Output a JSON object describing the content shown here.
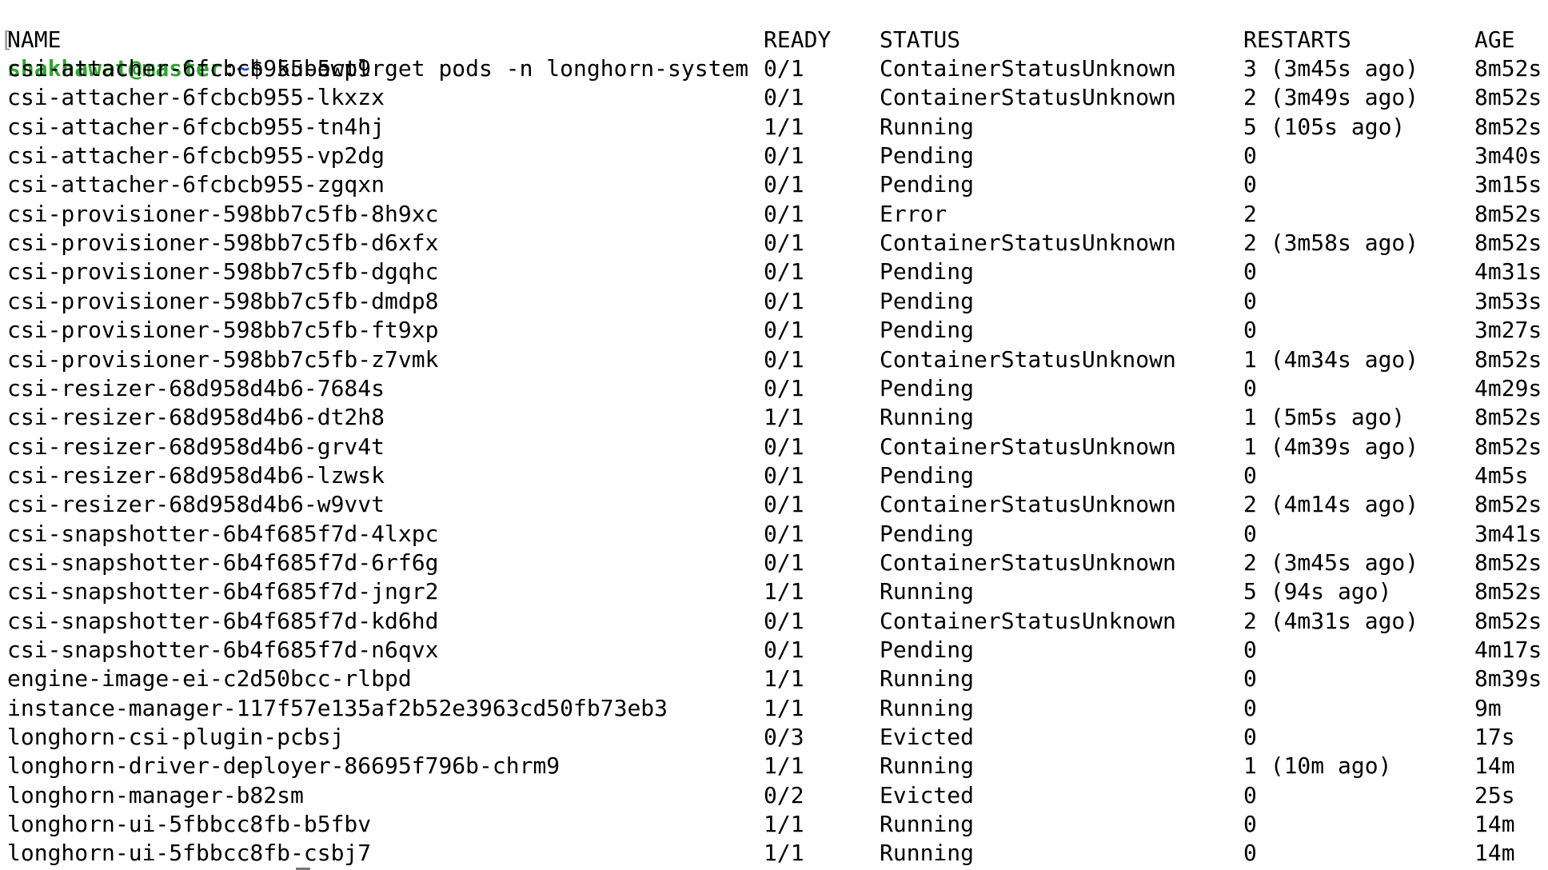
{
  "prompt": {
    "bracket": "[",
    "user_host": "shakhawat@master",
    "colon": ":",
    "path": "~",
    "symbol": "$",
    "command": " kubectl get pods -n longhorn-system"
  },
  "table": {
    "headers": [
      "NAME",
      "READY",
      "STATUS",
      "RESTARTS",
      "AGE"
    ],
    "rows": [
      [
        "csi-attacher-6fcbcb955-5wp9r",
        "0/1",
        "ContainerStatusUnknown",
        "3 (3m45s ago)",
        "8m52s"
      ],
      [
        "csi-attacher-6fcbcb955-lkxzx",
        "0/1",
        "ContainerStatusUnknown",
        "2 (3m49s ago)",
        "8m52s"
      ],
      [
        "csi-attacher-6fcbcb955-tn4hj",
        "1/1",
        "Running",
        "5 (105s ago)",
        "8m52s"
      ],
      [
        "csi-attacher-6fcbcb955-vp2dg",
        "0/1",
        "Pending",
        "0",
        "3m40s"
      ],
      [
        "csi-attacher-6fcbcb955-zgqxn",
        "0/1",
        "Pending",
        "0",
        "3m15s"
      ],
      [
        "csi-provisioner-598bb7c5fb-8h9xc",
        "0/1",
        "Error",
        "2",
        "8m52s"
      ],
      [
        "csi-provisioner-598bb7c5fb-d6xfx",
        "0/1",
        "ContainerStatusUnknown",
        "2 (3m58s ago)",
        "8m52s"
      ],
      [
        "csi-provisioner-598bb7c5fb-dgqhc",
        "0/1",
        "Pending",
        "0",
        "4m31s"
      ],
      [
        "csi-provisioner-598bb7c5fb-dmdp8",
        "0/1",
        "Pending",
        "0",
        "3m53s"
      ],
      [
        "csi-provisioner-598bb7c5fb-ft9xp",
        "0/1",
        "Pending",
        "0",
        "3m27s"
      ],
      [
        "csi-provisioner-598bb7c5fb-z7vmk",
        "0/1",
        "ContainerStatusUnknown",
        "1 (4m34s ago)",
        "8m52s"
      ],
      [
        "csi-resizer-68d958d4b6-7684s",
        "0/1",
        "Pending",
        "0",
        "4m29s"
      ],
      [
        "csi-resizer-68d958d4b6-dt2h8",
        "1/1",
        "Running",
        "1 (5m5s ago)",
        "8m52s"
      ],
      [
        "csi-resizer-68d958d4b6-grv4t",
        "0/1",
        "ContainerStatusUnknown",
        "1 (4m39s ago)",
        "8m52s"
      ],
      [
        "csi-resizer-68d958d4b6-lzwsk",
        "0/1",
        "Pending",
        "0",
        "4m5s"
      ],
      [
        "csi-resizer-68d958d4b6-w9vvt",
        "0/1",
        "ContainerStatusUnknown",
        "2 (4m14s ago)",
        "8m52s"
      ],
      [
        "csi-snapshotter-6b4f685f7d-4lxpc",
        "0/1",
        "Pending",
        "0",
        "3m41s"
      ],
      [
        "csi-snapshotter-6b4f685f7d-6rf6g",
        "0/1",
        "ContainerStatusUnknown",
        "2 (3m45s ago)",
        "8m52s"
      ],
      [
        "csi-snapshotter-6b4f685f7d-jngr2",
        "1/1",
        "Running",
        "5 (94s ago)",
        "8m52s"
      ],
      [
        "csi-snapshotter-6b4f685f7d-kd6hd",
        "0/1",
        "ContainerStatusUnknown",
        "2 (4m31s ago)",
        "8m52s"
      ],
      [
        "csi-snapshotter-6b4f685f7d-n6qvx",
        "0/1",
        "Pending",
        "0",
        "4m17s"
      ],
      [
        "engine-image-ei-c2d50bcc-rlbpd",
        "1/1",
        "Running",
        "0",
        "8m39s"
      ],
      [
        "instance-manager-117f57e135af2b52e3963cd50fb73eb3",
        "1/1",
        "Running",
        "0",
        "9m"
      ],
      [
        "longhorn-csi-plugin-pcbsj",
        "0/3",
        "Evicted",
        "0",
        "17s"
      ],
      [
        "longhorn-driver-deployer-86695f796b-chrm9",
        "1/1",
        "Running",
        "1 (10m ago)",
        "14m"
      ],
      [
        "longhorn-manager-b82sm",
        "0/2",
        "Evicted",
        "0",
        "25s"
      ],
      [
        "longhorn-ui-5fbbcc8fb-b5fbv",
        "1/1",
        "Running",
        "0",
        "14m"
      ],
      [
        "longhorn-ui-5fbbcc8fb-csbj7",
        "1/1",
        "Running",
        "0",
        "14m"
      ]
    ]
  },
  "colors": {
    "background": "#ffffff",
    "text": "#000000",
    "user_host": "#2fa52f",
    "path": "#2f4fd6"
  }
}
